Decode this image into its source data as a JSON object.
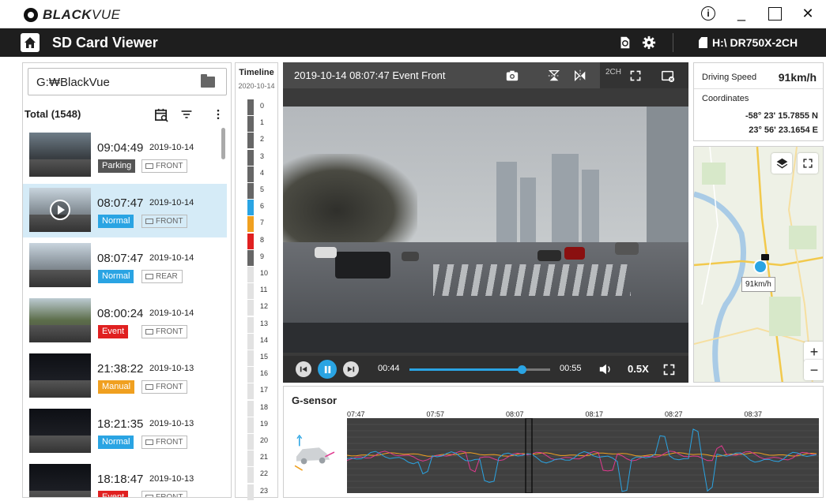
{
  "titlebar": {
    "logo_black": "BLACK",
    "logo_vue": "VUE",
    "minimize": "_",
    "close": "✕",
    "info": "i"
  },
  "header": {
    "title": "SD Card Viewer",
    "drive_label": "H:\\ DR750X-2CH"
  },
  "file_panel": {
    "path": "G:₩BlackVue",
    "total_label": "Total (1548)",
    "files": [
      {
        "time": "09:04:49",
        "date": "2019-10-14",
        "type": "Parking",
        "type_color": "#555555",
        "camera": "FRONT",
        "thumb": "dark",
        "selected": false
      },
      {
        "time": "08:07:47",
        "date": "2019-10-14",
        "type": "Normal",
        "type_color": "#2aa4e3",
        "camera": "FRONT",
        "thumb": "day",
        "selected": true
      },
      {
        "time": "08:07:47",
        "date": "2019-10-14",
        "type": "Normal",
        "type_color": "#2aa4e3",
        "camera": "REAR",
        "thumb": "day",
        "selected": false
      },
      {
        "time": "08:00:24",
        "date": "2019-10-14",
        "type": "Event",
        "type_color": "#e02020",
        "camera": "FRONT",
        "thumb": "green",
        "selected": false
      },
      {
        "time": "21:38:22",
        "date": "2019-10-13",
        "type": "Manual",
        "type_color": "#f0a020",
        "camera": "FRONT",
        "thumb": "night",
        "selected": false
      },
      {
        "time": "18:21:35",
        "date": "2019-10-13",
        "type": "Normal",
        "type_color": "#2aa4e3",
        "camera": "FRONT",
        "thumb": "night",
        "selected": false
      },
      {
        "time": "18:18:47",
        "date": "2019-10-13",
        "type": "Event",
        "type_color": "#e02020",
        "camera": "FRONT",
        "thumb": "night",
        "selected": false
      }
    ]
  },
  "timeline": {
    "title": "Timeline",
    "date": "2020-10-14",
    "hours": [
      "0",
      "1",
      "2",
      "3",
      "4",
      "5",
      "6",
      "7",
      "8",
      "9",
      "10",
      "11",
      "12",
      "13",
      "14",
      "15",
      "16",
      "17",
      "18",
      "19",
      "20",
      "21",
      "22",
      "23"
    ],
    "colors": [
      "#666666",
      "#666666",
      "#666666",
      "#666666",
      "#666666",
      "#666666",
      "#2aa4e3",
      "#f0a020",
      "#e02020",
      "#666666",
      "#e2e2e2",
      "#e2e2e2",
      "#e2e2e2",
      "#e2e2e2",
      "#e2e2e2",
      "#e2e2e2",
      "#e2e2e2",
      "#e2e2e2",
      "#e2e2e2",
      "#e2e2e2",
      "#e2e2e2",
      "#e2e2e2",
      "#e2e2e2",
      "#e2e2e2"
    ]
  },
  "video": {
    "title": "2019-10-14 08:07:47 Event Front",
    "channel_label": "2CH",
    "current_time": "00:44",
    "total_time": "00:55",
    "progress": 0.8,
    "speed": "0.5X"
  },
  "info": {
    "speed_label": "Driving Speed",
    "speed_value": "91km/h",
    "coords_label": "Coordinates",
    "lat": "-58° 23'  15.7855 N",
    "lon": "23° 56'  23.1654 E"
  },
  "map": {
    "speed_tag": "91km/h",
    "zoom_in": "+",
    "zoom_out": "−"
  },
  "gsensor": {
    "title": "G-sensor",
    "time_ticks": [
      "07:47",
      "07:57",
      "08:07",
      "08:17",
      "08:27",
      "08:37"
    ]
  }
}
